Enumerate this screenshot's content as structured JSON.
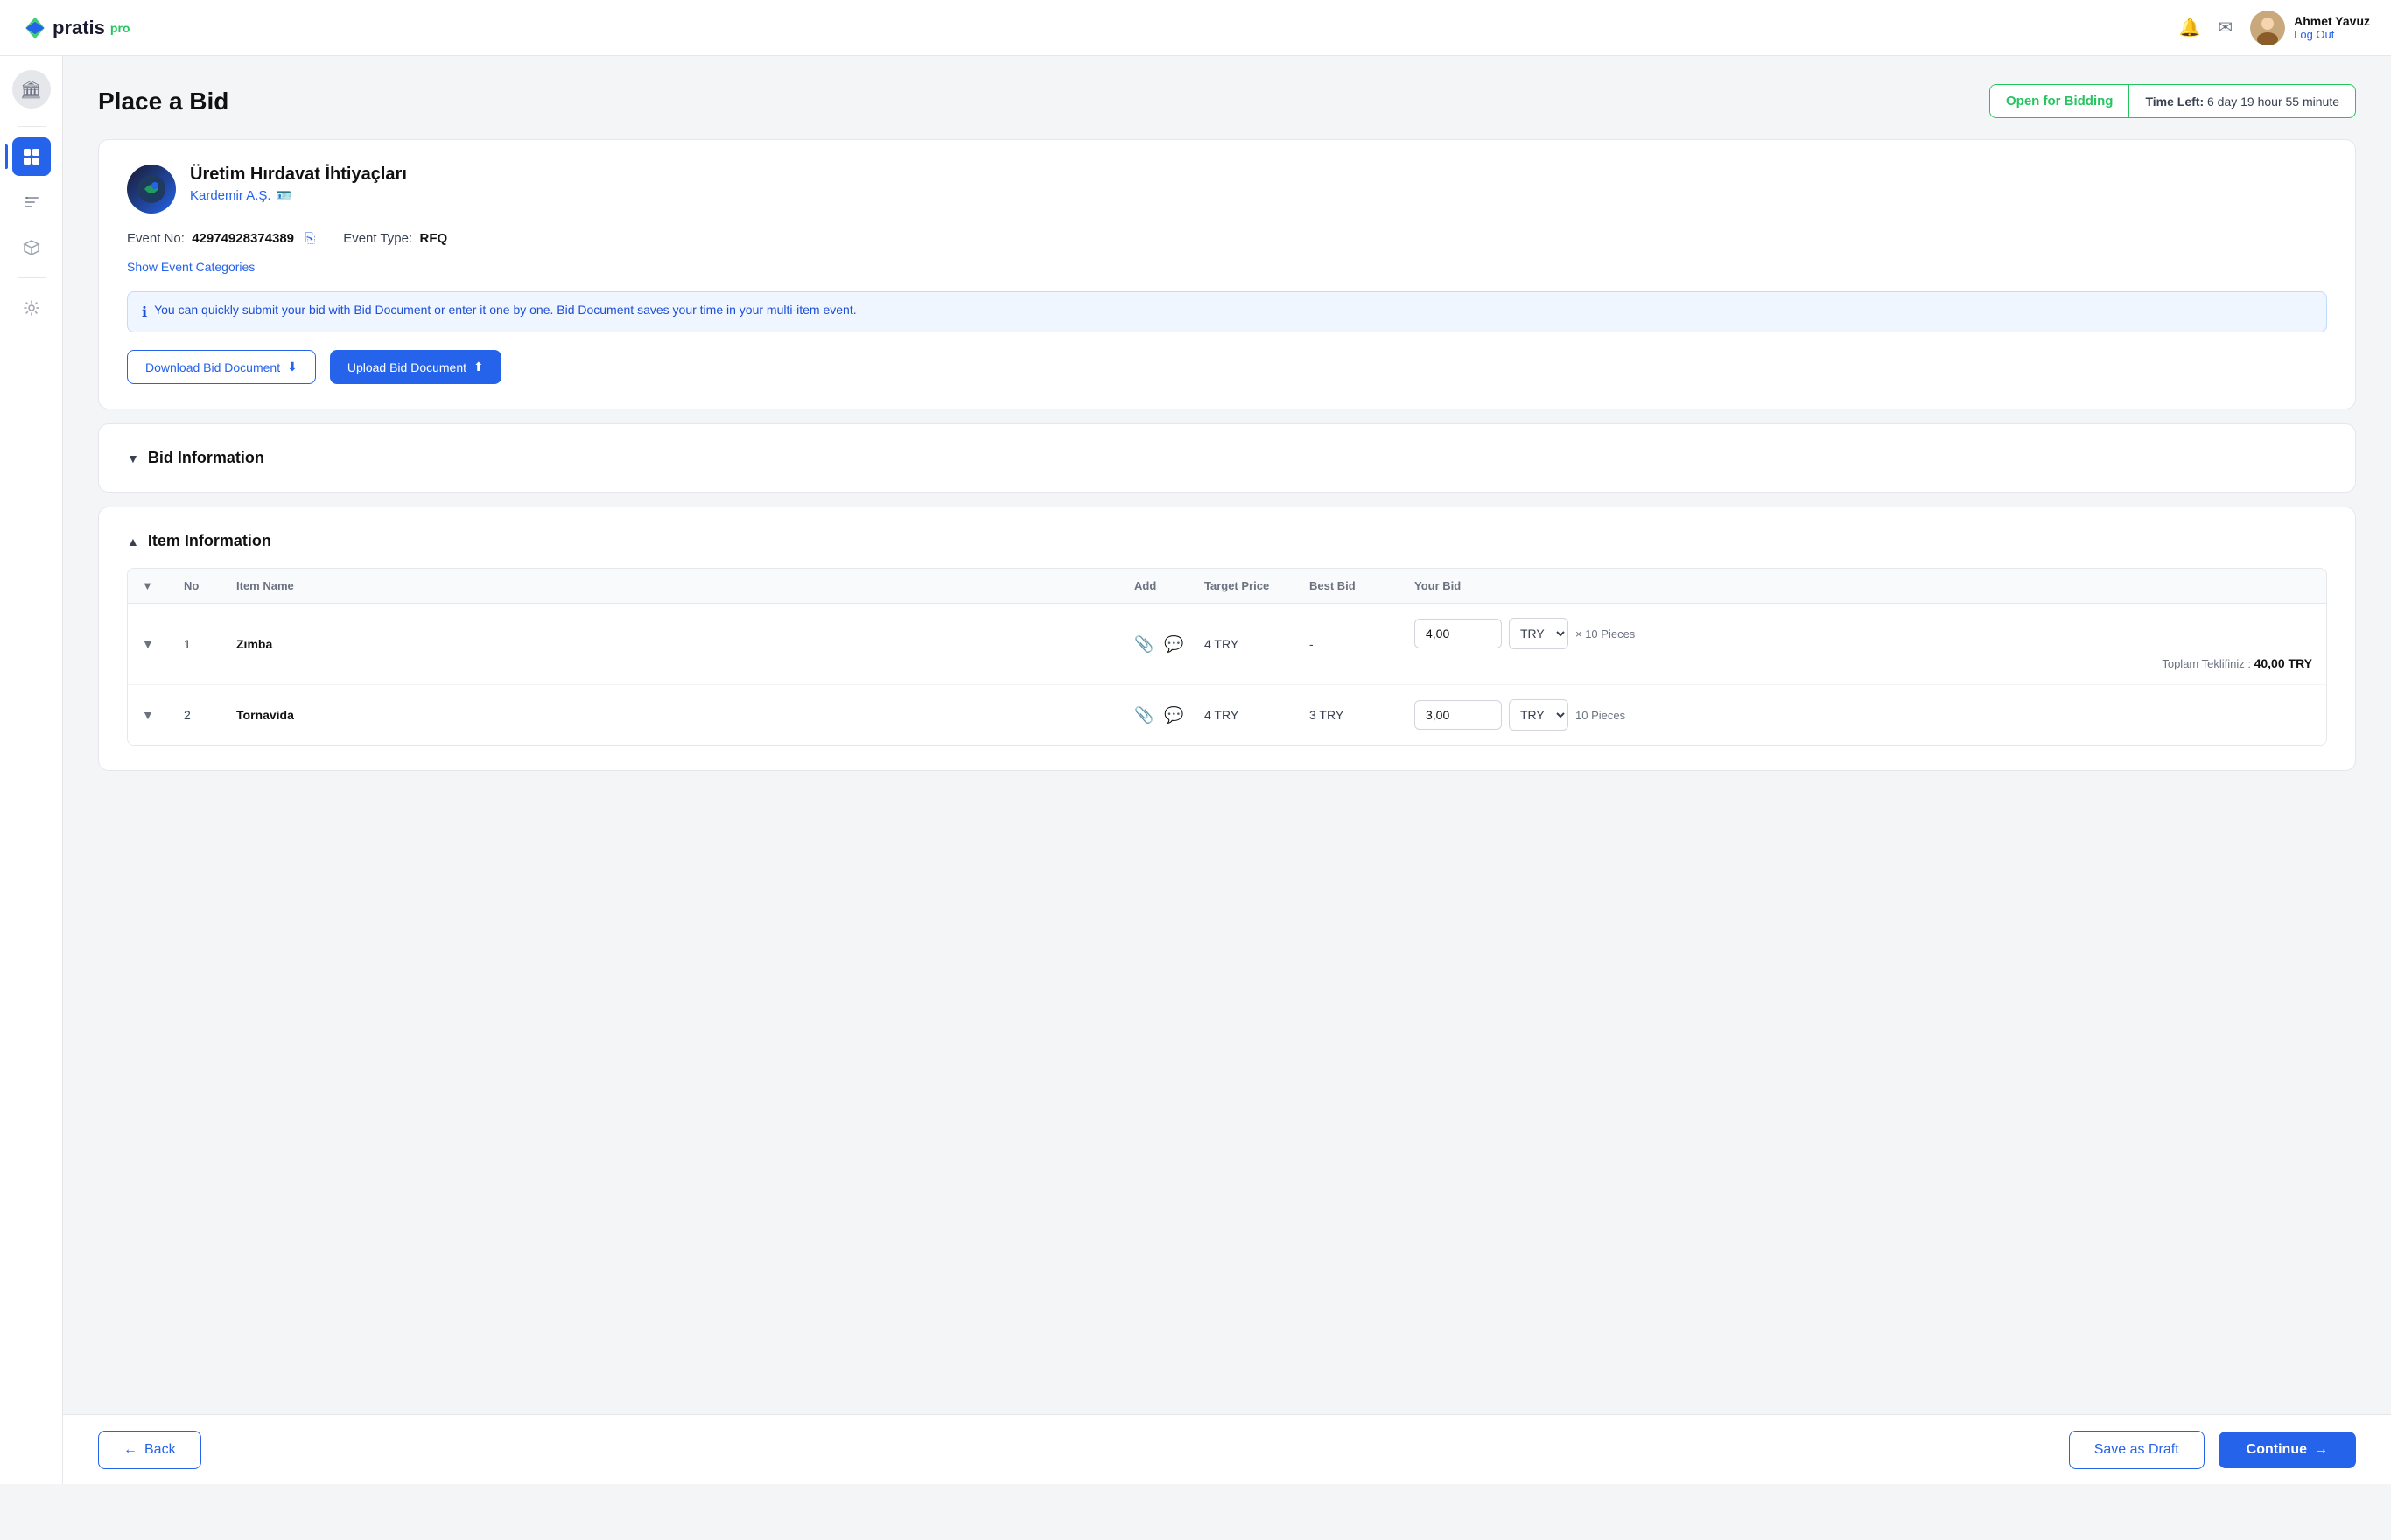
{
  "app": {
    "name": "pratis",
    "name_pro": "pro"
  },
  "topnav": {
    "user_name": "Ahmet Yavuz",
    "logout_label": "Log Out"
  },
  "status": {
    "label": "Open for Bidding",
    "time_left_prefix": "Time Left:",
    "time_left_value": "6 day 19 hour 55 minute"
  },
  "page": {
    "title": "Place a Bid"
  },
  "event": {
    "name": "Üretim Hırdavat İhtiyaçları",
    "company": "Kardemir A.Ş.",
    "event_no_label": "Event No:",
    "event_no_value": "42974928374389",
    "event_type_label": "Event Type:",
    "event_type_value": "RFQ",
    "show_categories_label": "Show Event Categories"
  },
  "info_message": "You can quickly submit your bid with Bid Document or enter it one by one. Bid Document saves your time in your multi-item event.",
  "buttons": {
    "download_bid_doc": "Download Bid Document",
    "upload_bid_doc": "Upload Bid Document",
    "back": "Back",
    "save_as_draft": "Save as Draft",
    "continue": "Continue"
  },
  "sections": {
    "bid_information": "Bid Information",
    "item_information": "Item Information"
  },
  "table": {
    "headers": [
      "",
      "No",
      "Item Name",
      "Add",
      "Target Price",
      "Best Bid",
      "Your Bid"
    ],
    "rows": [
      {
        "no": "1",
        "item_name": "Zımba",
        "target_price": "4 TRY",
        "best_bid": "-",
        "bid_value": "4,00",
        "currency": "TRY",
        "quantity": "10 Pieces",
        "total_label": "Toplam Teklifiniz :",
        "total_value": "40,00 TRY"
      },
      {
        "no": "2",
        "item_name": "Tornavida",
        "target_price": "4 TRY",
        "best_bid": "3 TRY",
        "bid_value": "3,00",
        "currency": "TRY",
        "quantity": "10 Pieces",
        "total_label": "",
        "total_value": ""
      }
    ]
  },
  "sidebar": {
    "items": [
      {
        "icon": "🏛",
        "name": "institution-icon",
        "active": false
      },
      {
        "icon": "⊞",
        "name": "grid-icon",
        "active": true
      },
      {
        "icon": "≡",
        "name": "list-icon",
        "active": false
      },
      {
        "icon": "⬡",
        "name": "cube-icon",
        "active": false
      },
      {
        "icon": "⚙",
        "name": "settings-icon",
        "active": false
      }
    ]
  }
}
